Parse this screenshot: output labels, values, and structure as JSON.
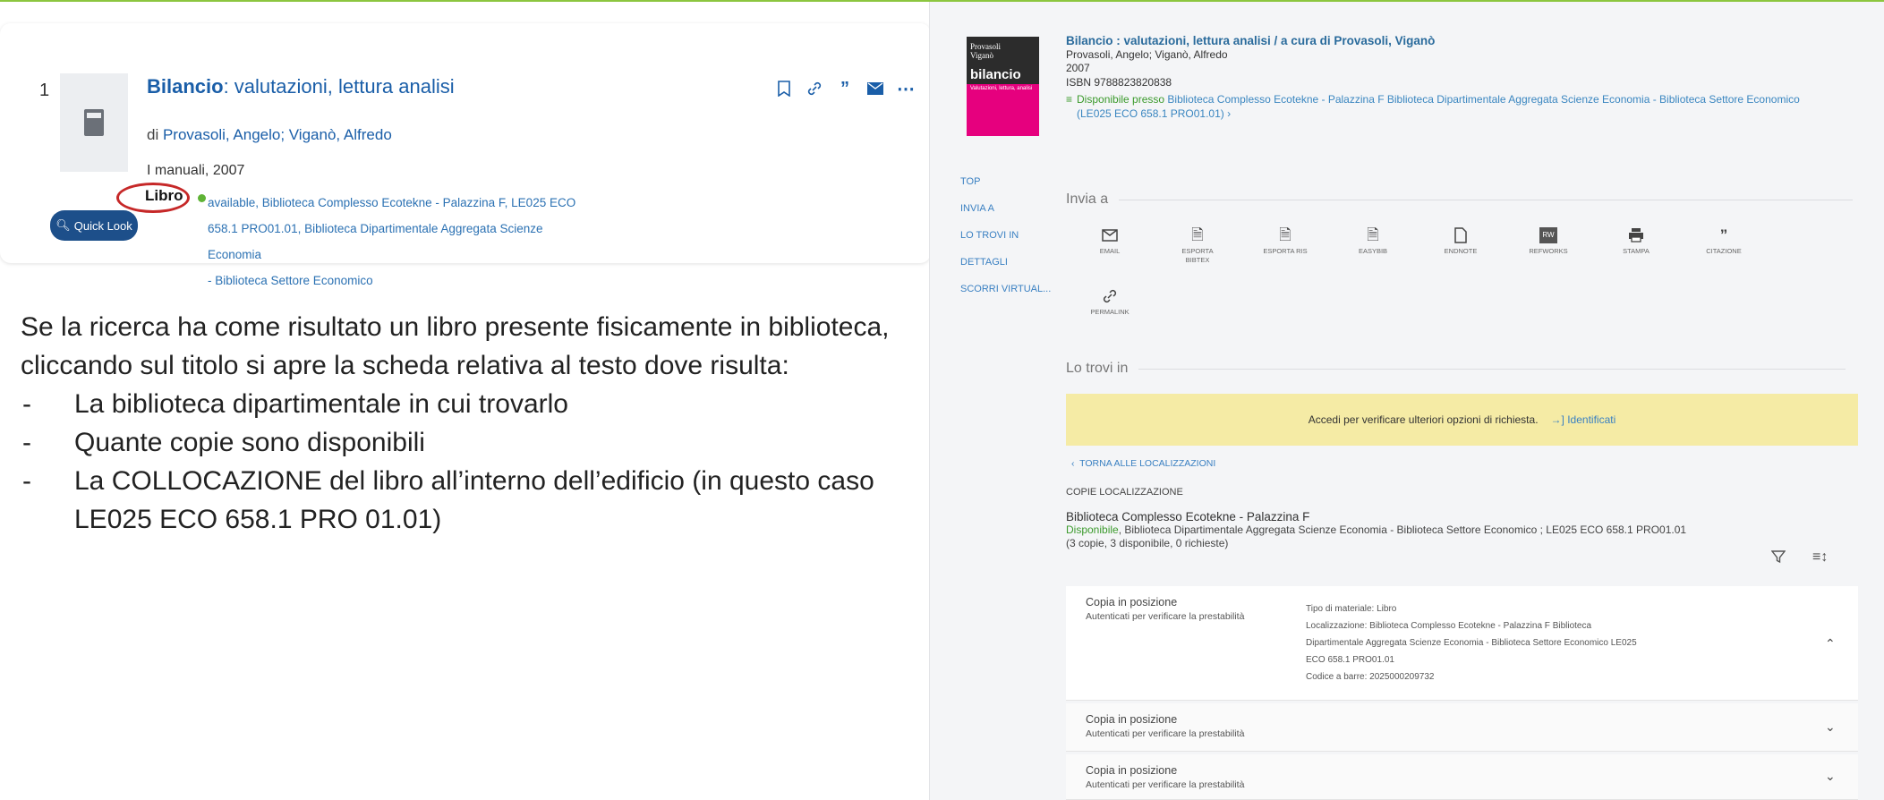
{
  "result_card": {
    "number": "1",
    "title_bold": "Bilancio",
    "title_rest": ": valutazioni, lettura analisi",
    "by_prefix": "di",
    "authors": "Provasoli, Angelo; Viganò, Alfredo",
    "series_year": "I manuali, 2007",
    "type": "Libro",
    "availability_line1": "available, Biblioteca Complesso Ecotekne - Palazzina F, LE025 ECO",
    "availability_line2": "658.1 PRO01.01, Biblioteca Dipartimentale Aggregata Scienze Economia",
    "availability_line3": "- Biblioteca Settore Economico",
    "quick_look": "Quick Look",
    "actions": [
      "bookmark-icon",
      "link-icon",
      "quote-icon",
      "email-icon",
      "more-icon"
    ]
  },
  "description": {
    "intro": "Se la ricerca ha come risultato un libro presente fisicamente in biblioteca, cliccando sul titolo si apre la scheda relativa al testo dove risulta:",
    "bullets": [
      "La biblioteca dipartimentale in cui trovarlo",
      "Quante copie sono disponibili",
      "La COLLOCAZIONE del libro all’interno dell’edificio (in questo caso LE025 ECO 658.1 PRO 01.01)"
    ]
  },
  "record": {
    "cover": {
      "authors": "Provasoli\nViganò",
      "title": "bilancio",
      "subtitle": "Valutazioni, lettura, analisi"
    },
    "title": "Bilancio : valutazioni, lettura analisi / a cura di Provasoli, Viganò",
    "authors": "Provasoli, Angelo; Viganò, Alfredo",
    "year": "2007",
    "isbn": "ISBN 9788823820838",
    "available_at_label": "Disponibile presso",
    "available_at": "Biblioteca Complesso Ecotekne - Palazzina F  Biblioteca Dipartimentale Aggregata Scienze Economia - Biblioteca Settore Economico (LE025 ECO 658.1 PRO01.01)",
    "side_nav": [
      "TOP",
      "INVIA A",
      "LO TROVI IN",
      "DETTAGLI",
      "SCORRI VIRTUAL..."
    ],
    "send_to_heading": "Invia a",
    "send_to": [
      {
        "label": "EMAIL",
        "icon": "email-icon"
      },
      {
        "label": "ESPORTA BIBTEX",
        "icon": "file-icon"
      },
      {
        "label": "ESPORTA RIS",
        "icon": "file-icon"
      },
      {
        "label": "EASYBIB",
        "icon": "file-icon"
      },
      {
        "label": "ENDNOTE",
        "icon": "document-icon"
      },
      {
        "label": "REFWORKS",
        "icon": "refworks-icon"
      },
      {
        "label": "STAMPA",
        "icon": "printer-icon"
      },
      {
        "label": "CITAZIONE",
        "icon": "quote-icon"
      }
    ],
    "permalink": "PERMALINK",
    "find_in_heading": "Lo trovi in",
    "banner_text": "Accedi per verificare ulteriori opzioni di richiesta.",
    "banner_link": "Identificati",
    "back_link": "TORNA ALLE LOCALIZZAZIONI",
    "copies_heading": "COPIE LOCALIZZAZIONE",
    "library_name": "Biblioteca Complesso Ecotekne - Palazzina F",
    "library_status": "Disponibile",
    "library_detail": ", Biblioteca Dipartimentale Aggregata Scienze Economia - Biblioteca Settore Economico ; LE025 ECO 658.1 PRO01.01",
    "library_counts": "(3 copie, 3 disponibile, 0 richieste)",
    "copies": [
      {
        "title": "Copia in posizione",
        "sub": "Autenticati per verificare la prestabilità"
      },
      {
        "title": "Copia in posizione",
        "sub": "Autenticati per verificare la prestabilità"
      },
      {
        "title": "Copia in posizione",
        "sub": "Autenticati per verificare la prestabilità"
      }
    ],
    "copy_details": {
      "material": "Tipo di materiale: Libro",
      "location_1": "Localizzazione: Biblioteca Complesso Ecotekne - Palazzina F Biblioteca",
      "location_2": "Dipartimentale Aggregata Scienze Economia - Biblioteca Settore Economico LE025",
      "location_3": "ECO 658.1 PRO01.01",
      "barcode": "Codice a barre: 2025000209732"
    }
  }
}
